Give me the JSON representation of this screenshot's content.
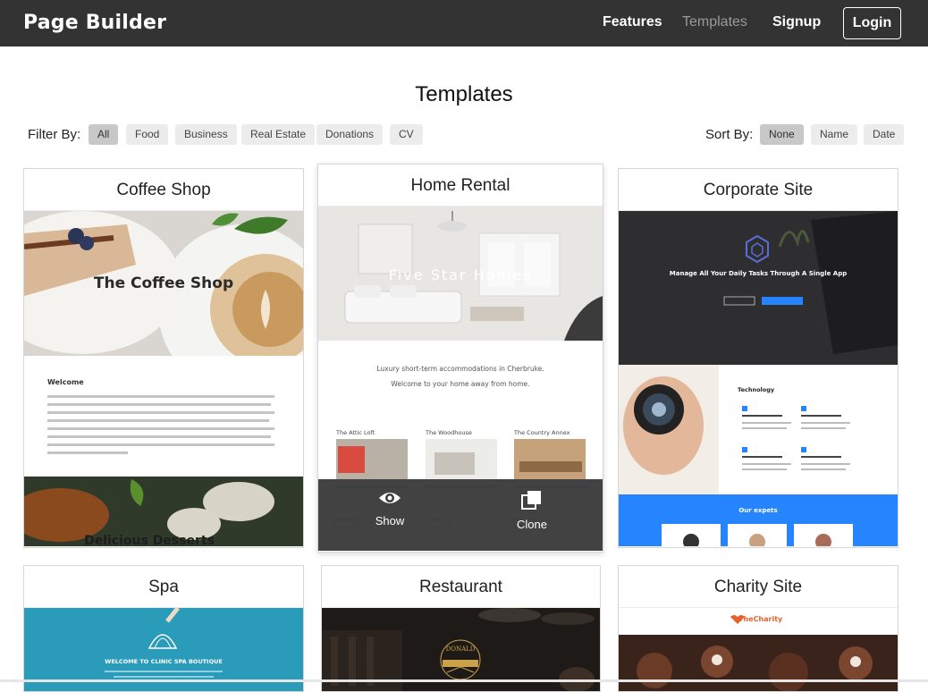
{
  "brand": "Page Builder",
  "nav": {
    "features": "Features",
    "templates": "Templates",
    "signup": "Signup",
    "login": "Login"
  },
  "page_title": "Templates",
  "filter": {
    "label": "Filter By:",
    "options": [
      "All",
      "Food",
      "Business",
      "Real Estate",
      "Donations",
      "CV"
    ],
    "active": "All"
  },
  "sort": {
    "label": "Sort By:",
    "options": [
      "None",
      "Name",
      "Date"
    ],
    "active": "None"
  },
  "cards": [
    {
      "title": "Coffee Shop",
      "thumb_heading": "The Coffee Shop",
      "thumb_welcome": "Welcome",
      "thumb_footer": "Delicious Desserts"
    },
    {
      "title": "Home Rental",
      "thumb_heading": "Five Star Homes",
      "thumb_tagline1": "Luxury short-term accommodations in Cherbruke.",
      "thumb_tagline2": "Welcome to your home away from home.",
      "listings": [
        "The Attic Loft",
        "The Woodhouse",
        "The Country Annex"
      ],
      "overlay": {
        "show": "Show",
        "clone": "Clone"
      }
    },
    {
      "title": "Corporate Site",
      "thumb_heading": "Manage All Your Daily Tasks Through A Single App",
      "thumb_section": "Technology",
      "thumb_experts": "Our expets"
    },
    {
      "title": "Spa",
      "thumb_heading": "WELCOME TO CLINIC SPA BOUTIQUE"
    },
    {
      "title": "Restaurant",
      "thumb_logo": "DONALD"
    },
    {
      "title": "Charity Site",
      "thumb_brand": "TheCharity"
    }
  ],
  "colors": {
    "topbar": "#333333",
    "accent_blue": "#2684ff",
    "spa_teal": "#2a9bb8",
    "charity_orange": "#e8622c"
  }
}
